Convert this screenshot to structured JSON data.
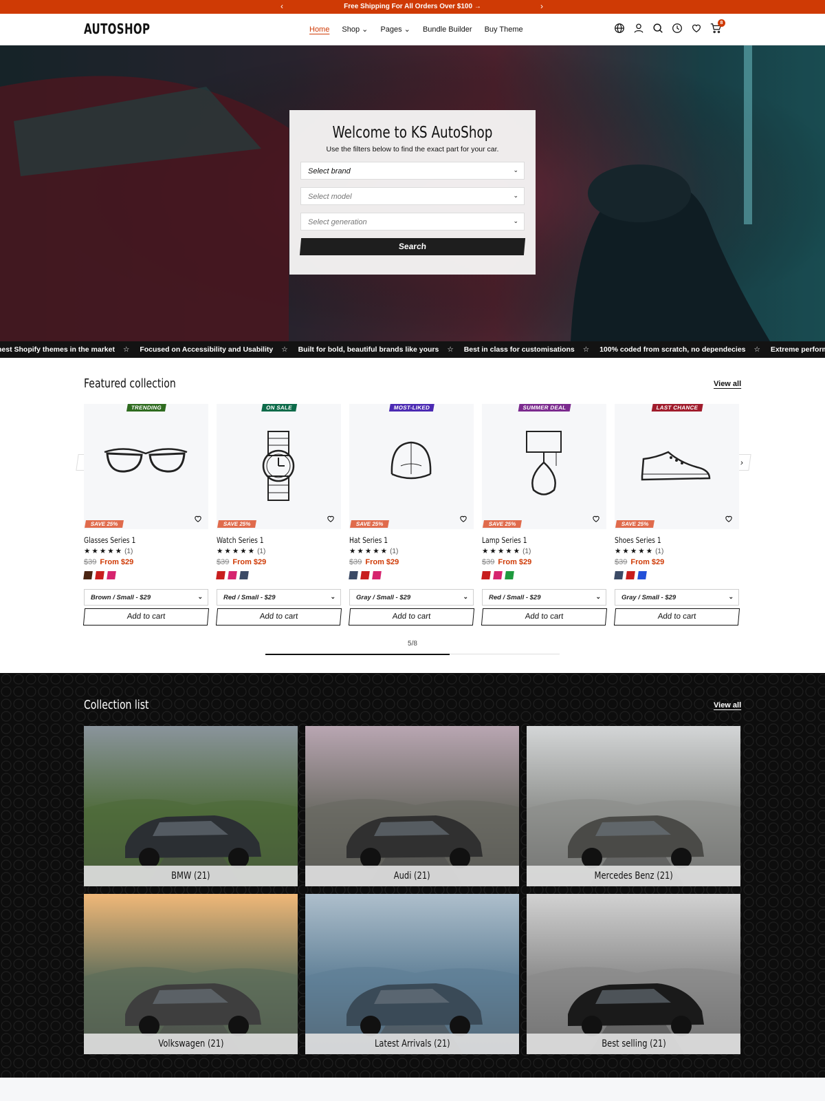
{
  "announcement": {
    "text": "Free Shipping For All Orders Over $100",
    "arrow": "→"
  },
  "header": {
    "logo": "AUTOSHOP",
    "nav": [
      {
        "label": "Home",
        "active": true
      },
      {
        "label": "Shop ⌄"
      },
      {
        "label": "Pages ⌄"
      },
      {
        "label": "Bundle Builder"
      },
      {
        "label": "Buy Theme"
      }
    ],
    "cart_count": "8",
    "icons": [
      "globe-icon",
      "user-icon",
      "search-icon",
      "clock-icon",
      "heart-icon",
      "cart-icon"
    ]
  },
  "hero": {
    "title": "Welcome to KS AutoShop",
    "subtitle": "Use the filters below to find the exact part for your car.",
    "select_brand": "Select brand",
    "select_model": "Select model",
    "select_generation": "Select generation",
    "search_label": "Search"
  },
  "marquee": [
    "nest Shopify themes in the market",
    "Focused on Accessibility and Usability",
    "Built for bold, beautiful brands like yours",
    "Best in class for customisations",
    "100% coded from scratch, no dependecies",
    "Extreme performance, sup"
  ],
  "featured": {
    "title": "Featured collection",
    "view_all": "View all",
    "pager": "5/8",
    "progress": 0.625,
    "products": [
      {
        "tag": "TRENDING",
        "tag_color": "#2e6b1f",
        "save": "SAVE 25%",
        "name": "Glasses Series 1",
        "stars": "★★★★★",
        "count": "(1)",
        "old_price": "$39",
        "new_price": "From $29",
        "swatches": [
          "#4a2412",
          "#c81e1e",
          "#d6246e"
        ],
        "variant": "Brown / Small - $29",
        "atc": "Add to cart",
        "icon": "glasses"
      },
      {
        "tag": "ON SALE",
        "tag_color": "#0d6b4a",
        "save": "SAVE 25%",
        "name": "Watch Series 1",
        "stars": "★★★★★",
        "count": "(1)",
        "old_price": "$39",
        "new_price": "From $29",
        "swatches": [
          "#c81e1e",
          "#d6246e",
          "#3b4a66"
        ],
        "variant": "Red / Small - $29",
        "atc": "Add to cart",
        "icon": "watch"
      },
      {
        "tag": "MOST-LIKED",
        "tag_color": "#4b2ab3",
        "save": "SAVE 25%",
        "name": "Hat Series 1",
        "stars": "★★★★★",
        "count": "(1)",
        "old_price": "$39",
        "new_price": "From $29",
        "swatches": [
          "#3b4a66",
          "#c81e1e",
          "#d6246e"
        ],
        "variant": "Gray / Small - $29",
        "atc": "Add to cart",
        "icon": "cap"
      },
      {
        "tag": "SUMMER DEAL",
        "tag_color": "#7b2a8e",
        "save": "SAVE 25%",
        "name": "Lamp Series 1",
        "stars": "★★★★★",
        "count": "(1)",
        "old_price": "$39",
        "new_price": "From $29",
        "swatches": [
          "#c81e1e",
          "#d6246e",
          "#1e9a3e"
        ],
        "variant": "Red / Small - $29",
        "atc": "Add to cart",
        "icon": "lamp"
      },
      {
        "tag": "LAST CHANCE",
        "tag_color": "#a01c2c",
        "save": "SAVE 25%",
        "name": "Shoes Series 1",
        "stars": "★★★★★",
        "count": "(1)",
        "old_price": "$39",
        "new_price": "From $29",
        "swatches": [
          "#3b4a66",
          "#c81e1e",
          "#2350d8"
        ],
        "variant": "Gray / Small - $29",
        "atc": "Add to cart",
        "icon": "shoe"
      }
    ]
  },
  "collections": {
    "title": "Collection list",
    "view_all": "View all",
    "items": [
      {
        "label": "BMW (21)",
        "palette": [
          "#8a949c",
          "#4f6b3a",
          "#2b2f33"
        ]
      },
      {
        "label": "Audi (21)",
        "palette": [
          "#b9a6b2",
          "#6a6a63",
          "#303030"
        ]
      },
      {
        "label": "Mercedes Benz (21)",
        "palette": [
          "#d4d6d7",
          "#8d8f8c",
          "#4a4a47"
        ]
      },
      {
        "label": "Volkswagen (21)",
        "palette": [
          "#f0b878",
          "#5e6d5a",
          "#3e3e3e"
        ]
      },
      {
        "label": "Latest Arrivals (21)",
        "palette": [
          "#aebfcc",
          "#5f7f96",
          "#3a4a57"
        ]
      },
      {
        "label": "Best selling (21)",
        "palette": [
          "#d2d2d2",
          "#8a8a8a",
          "#1a1a1a"
        ]
      }
    ]
  }
}
